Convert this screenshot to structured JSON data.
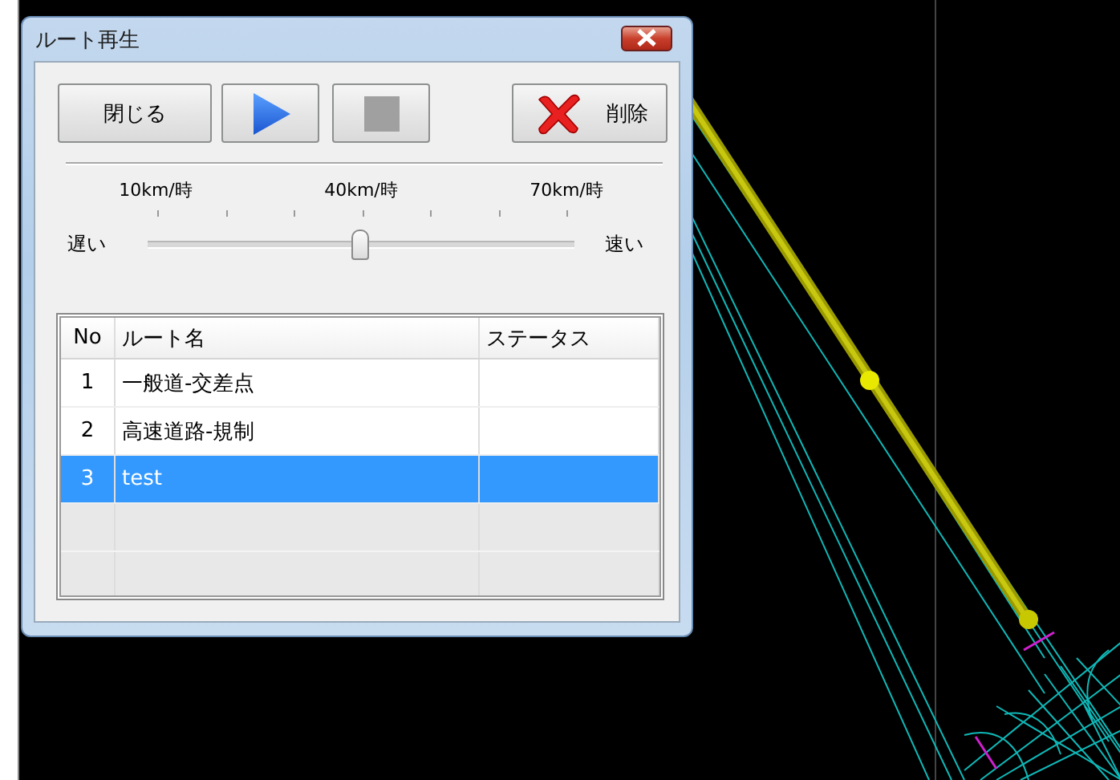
{
  "window": {
    "title": "ルート再生"
  },
  "buttons": [
    {
      "kind": "text",
      "label": "閉じる"
    },
    {
      "kind": "play"
    },
    {
      "kind": "stop"
    },
    {
      "kind": "delete",
      "label": "削除"
    }
  ],
  "speed_slider": {
    "tick_labels": [
      "10km/時",
      "40km/時",
      "70km/時"
    ],
    "min_label": "遅い",
    "max_label": "速い",
    "level": 0.5
  },
  "table": {
    "columns": [
      "No",
      "ルート名",
      "ステータス"
    ],
    "rows": [
      {
        "no": "1",
        "name": "一般道-交差点",
        "selected": false
      },
      {
        "no": "2",
        "name": "高速道路-規制",
        "selected": false
      },
      {
        "no": "3",
        "name": "test",
        "selected": true
      }
    ]
  }
}
